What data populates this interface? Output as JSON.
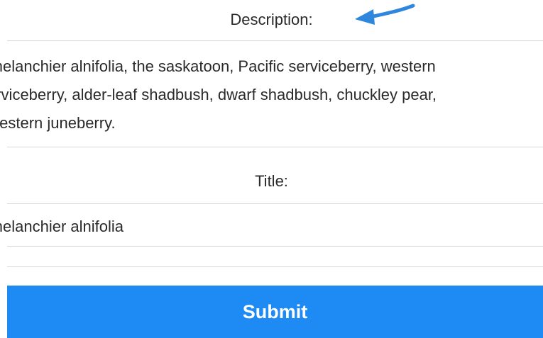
{
  "description": {
    "label": "Description:",
    "lines": [
      "Amelanchier alnifolia, the saskatoon, Pacific serviceberry, western",
      "serviceberry, alder-leaf shadbush, dwarf shadbush, chuckley pear,",
      "  western juneberry."
    ]
  },
  "title": {
    "label": "Title:",
    "value": "Amelanchier alnifolia"
  },
  "submit": {
    "label": "Submit"
  },
  "colors": {
    "accent": "#1e8bf5",
    "arrow": "#2f86dd",
    "divider": "#d8d8d8"
  },
  "icons": {
    "pointer": "arrow-left-icon"
  }
}
